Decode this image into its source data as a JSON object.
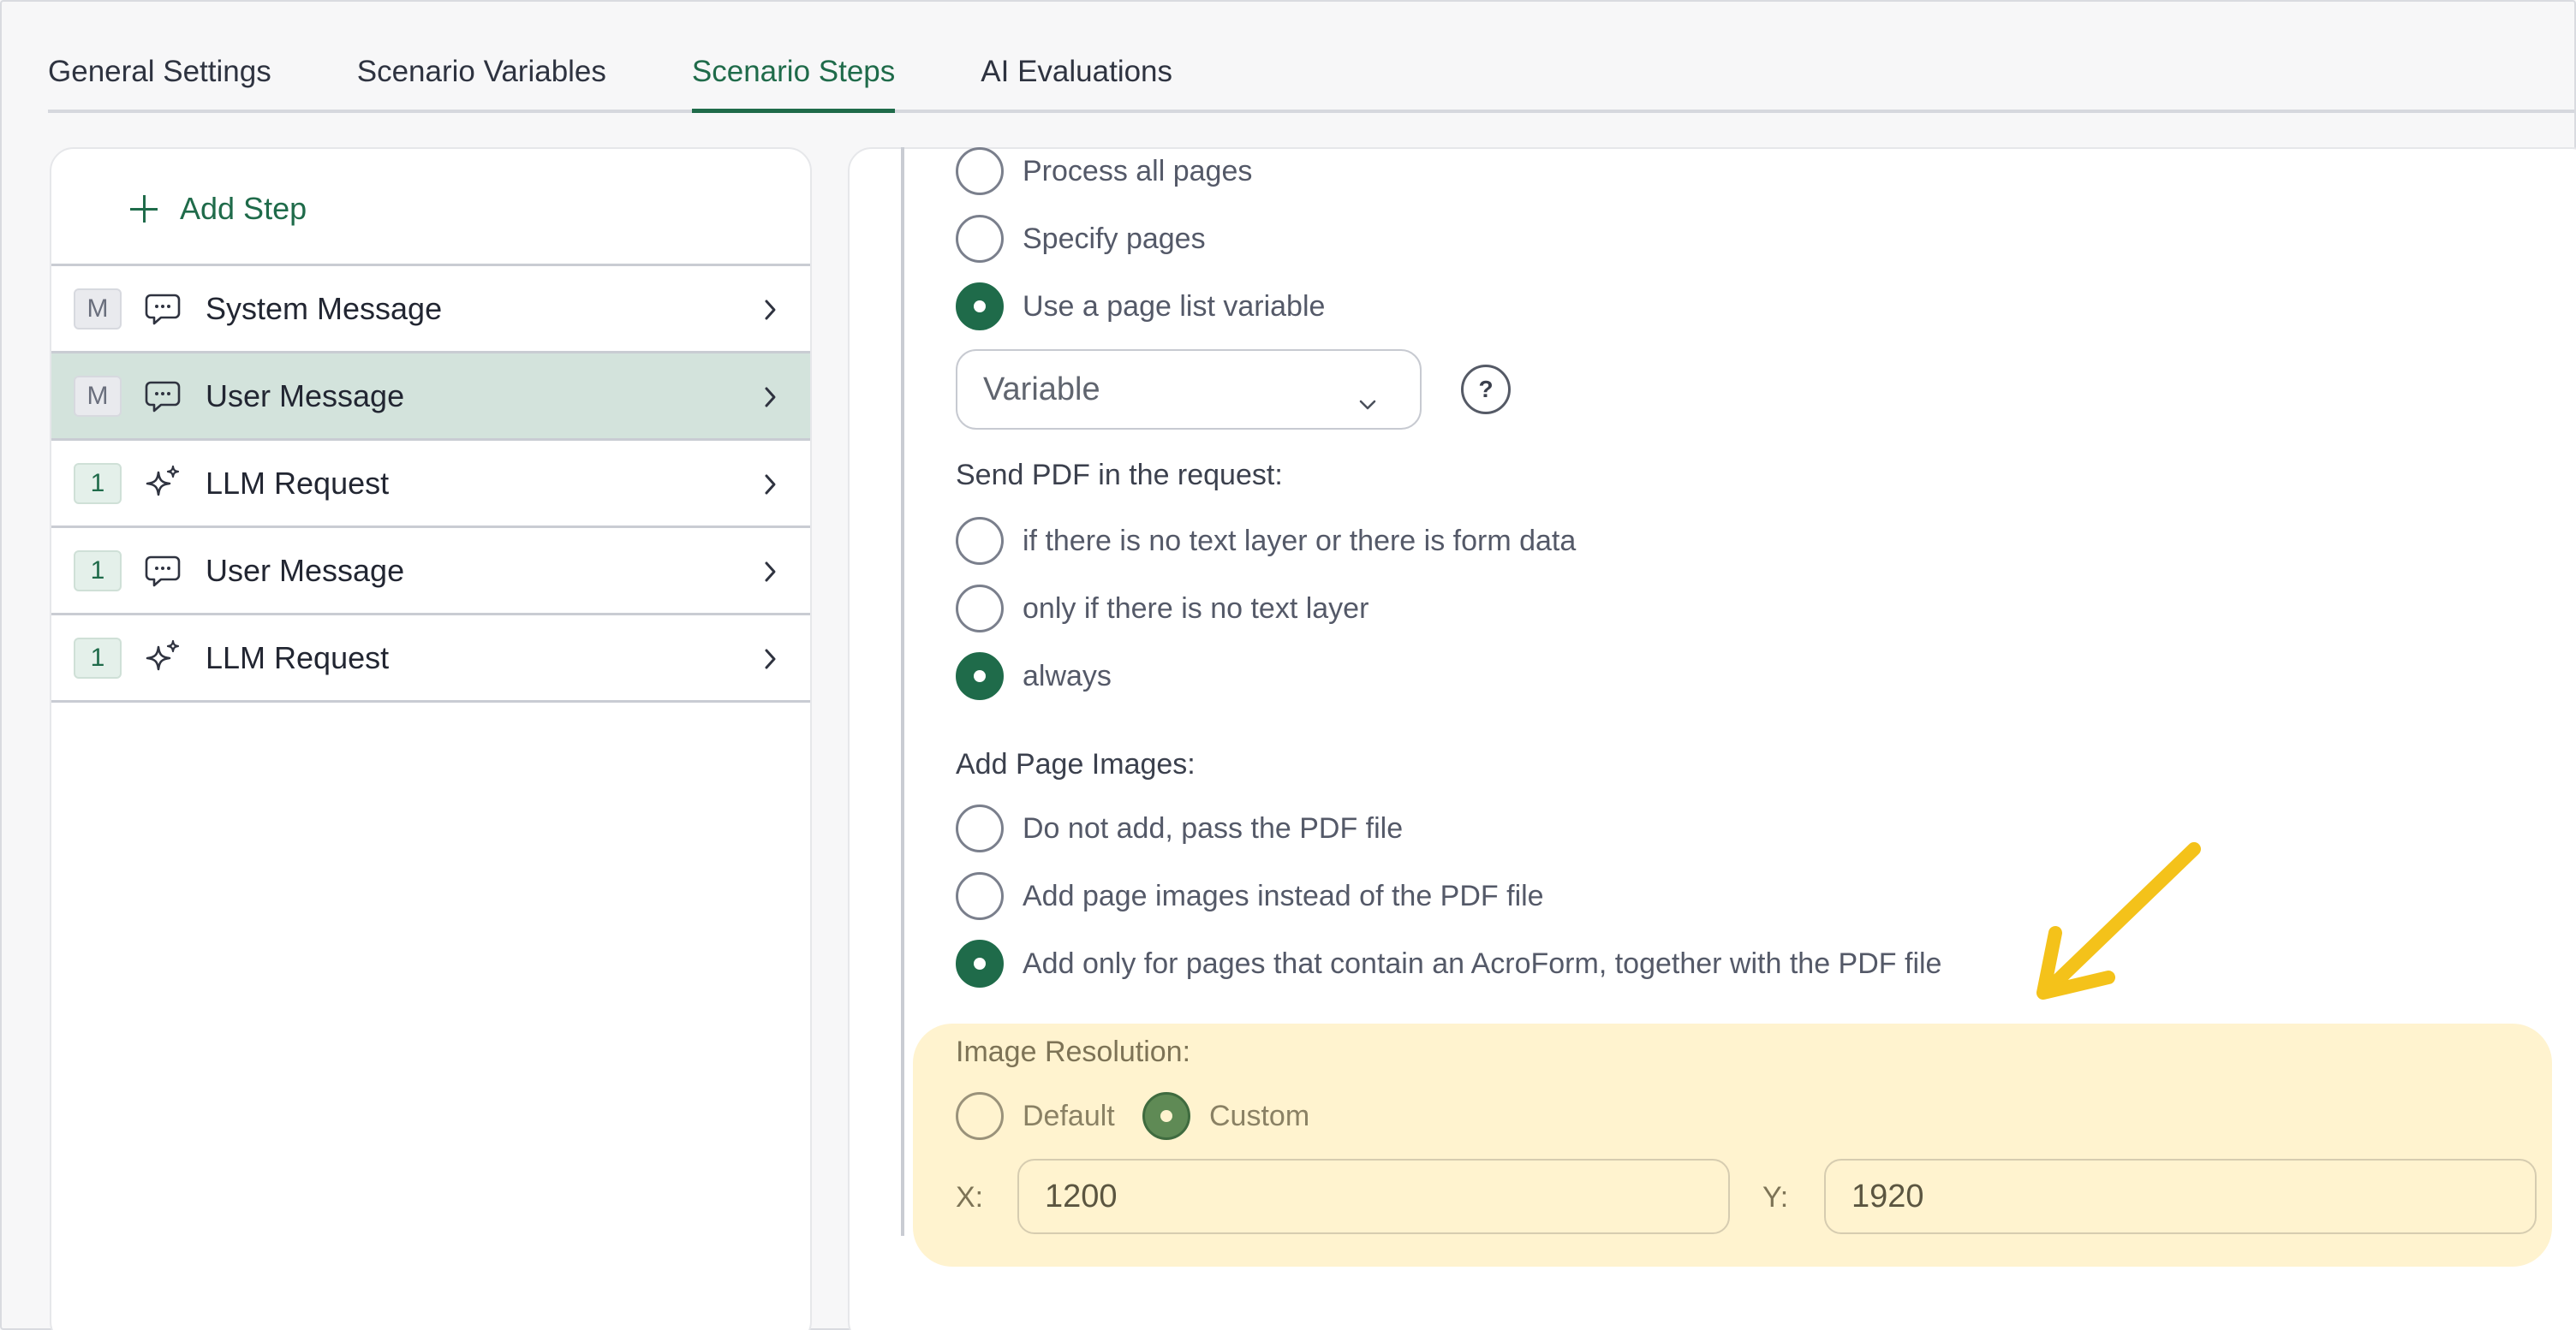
{
  "tabs": [
    {
      "label": "General Settings"
    },
    {
      "label": "Scenario Variables"
    },
    {
      "label": "Scenario Steps",
      "active": true
    },
    {
      "label": "AI Evaluations"
    }
  ],
  "sidebar": {
    "add_step_label": "Add Step",
    "steps": [
      {
        "badge": "M",
        "icon": "chat-bubble-icon",
        "label": "System Message",
        "selected": false
      },
      {
        "badge": "M",
        "icon": "chat-bubble-icon",
        "label": "User Message",
        "selected": true
      },
      {
        "badge": "1",
        "icon": "sparkles-icon",
        "label": "LLM Request",
        "selected": false
      },
      {
        "badge": "1",
        "icon": "chat-bubble-icon",
        "label": "User Message",
        "selected": false
      },
      {
        "badge": "1",
        "icon": "sparkles-icon",
        "label": "LLM Request",
        "selected": false
      }
    ]
  },
  "pages_options": {
    "options": [
      {
        "label": "Process all pages",
        "checked": false
      },
      {
        "label": "Specify pages",
        "checked": false
      },
      {
        "label": "Use a page list variable",
        "checked": true
      }
    ],
    "variable_select_value": "Variable",
    "help_label": "?"
  },
  "send_pdf": {
    "label": "Send PDF in the request:",
    "options": [
      {
        "label": "if there is no text layer or there is form data",
        "checked": false
      },
      {
        "label": "only if there is no text layer",
        "checked": false
      },
      {
        "label": "always",
        "checked": true
      }
    ]
  },
  "page_images": {
    "label": "Add Page Images:",
    "options": [
      {
        "label": "Do not add, pass the PDF file",
        "checked": false
      },
      {
        "label": "Add page images instead of the PDF file",
        "checked": false
      },
      {
        "label": "Add only for pages that contain an AcroForm, together with the PDF file",
        "checked": true
      }
    ]
  },
  "image_resolution": {
    "label": "Image Resolution:",
    "options": [
      {
        "label": "Default",
        "checked": false
      },
      {
        "label": "Custom",
        "checked": true
      }
    ],
    "x_label": "X:",
    "x_value": "1200",
    "y_label": "Y:",
    "y_value": "1920"
  },
  "colors": {
    "accent": "#1f6b4a",
    "selected_row": "#d3e3dc",
    "highlight": "#fff3cf",
    "annotation_arrow": "#f4c21a"
  }
}
